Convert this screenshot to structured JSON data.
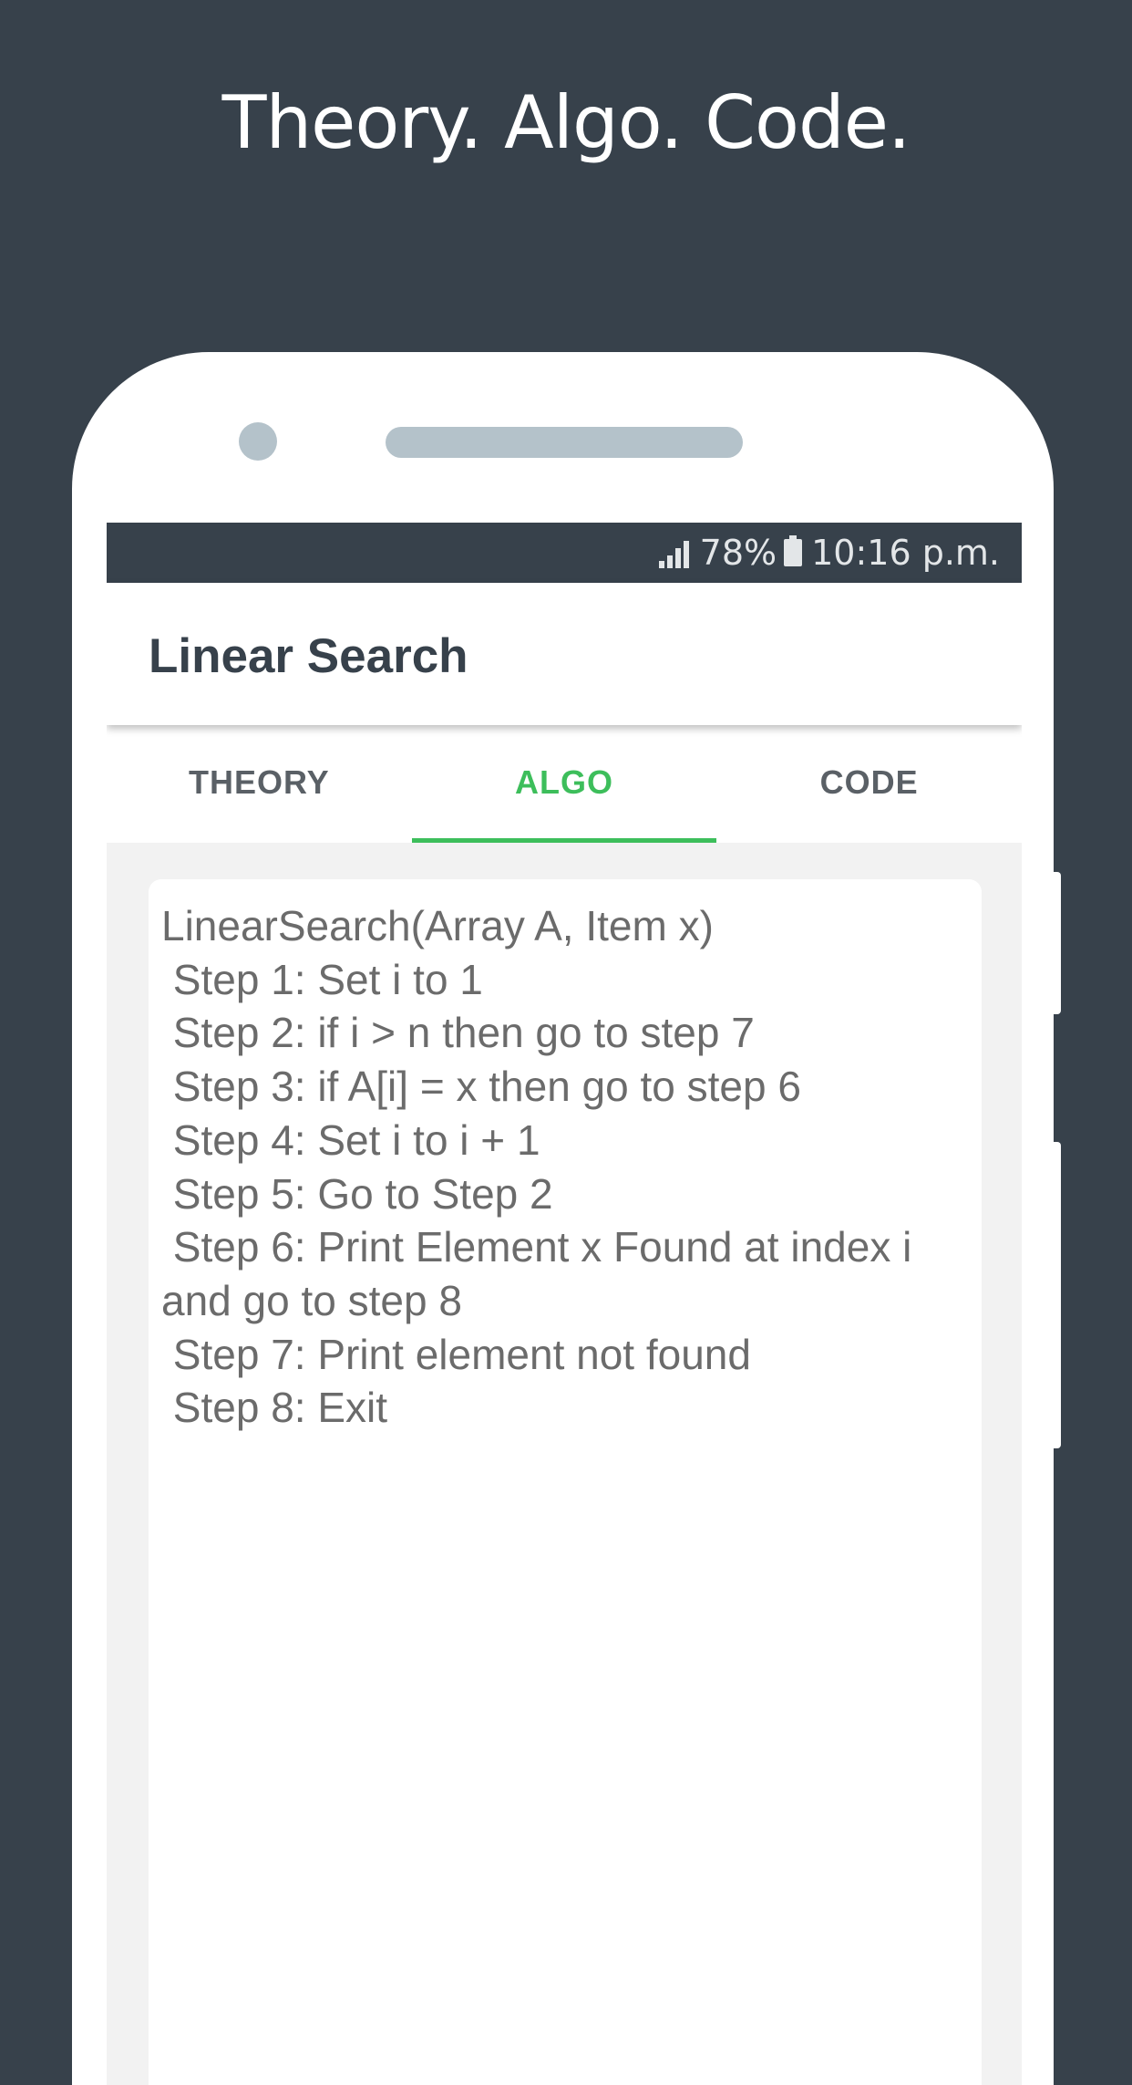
{
  "headline": "Theory. Algo. Code.",
  "status_bar": {
    "battery": "78%",
    "time": "10:16 p.m."
  },
  "app_bar": {
    "title": "Linear Search"
  },
  "tabs": [
    {
      "label": "THEORY",
      "active": false
    },
    {
      "label": "ALGO",
      "active": true
    },
    {
      "label": "CODE",
      "active": false
    }
  ],
  "colors": {
    "background": "#37414b",
    "accent": "#3dbe5b"
  },
  "algorithm_text": "LinearSearch(Array A, Item x)\n Step 1: Set i to 1\n Step 2: if i > n then go to step 7\n Step 3: if A[i] = x then go to step 6\n Step 4: Set i to i + 1\n Step 5: Go to Step 2\n Step 6: Print Element x Found at index i\nand go to step 8\n Step 7: Print element not found\n Step 8: Exit"
}
